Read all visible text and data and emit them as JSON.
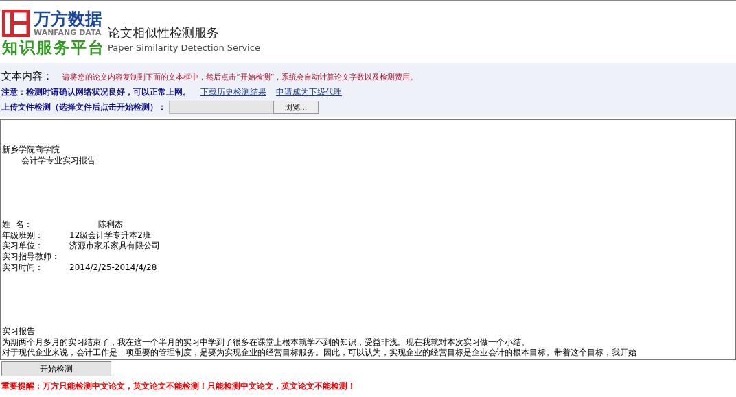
{
  "header": {
    "brand": "万方数据",
    "brand_en": "WANFANG DATA",
    "platform": "知识服务平台",
    "service_title": "论文相似性检测服务",
    "service_title_en": "Paper Similarity Detection Service"
  },
  "info": {
    "label": "文本内容：",
    "instruction": "请将您的论文内容复制到下面的文本框中，然后点击“开始检测”，系统会自动计算论文字数以及检测费用。",
    "notice": "注意：检测时请确认网络状况良好，可以正常上网。",
    "links": [
      "下载历史检测结果",
      "申请成为下级代理"
    ],
    "upload_label": "上传文件检测（选择文件后点击开始检测）：",
    "browse_button": "浏览..."
  },
  "text_box": {
    "school": "新乡学院商学院",
    "report_title": "会计学专业实习报告",
    "fields": [
      {
        "label": "姓  名：",
        "value": "陈利杰"
      },
      {
        "label": "年级班别：",
        "value": "12级会计学专升本2班"
      },
      {
        "label": "实习单位：",
        "value": "济源市家乐家具有限公司"
      },
      {
        "label": "实习指导教师："
      },
      {
        "label": "实习时间：",
        "value": "2014/2/25-2014/4/28"
      }
    ],
    "section_title": "实习报告",
    "paragraphs": [
      "为期两个月多月的实习结束了，我在这一个半月的实习中学到了很多在课堂上根本就学不到的知识，受益非浅。现在我就对本次实习做一个小结。",
      "对于现代企业来说，会计工作是一项重要的管理制度，是要为实现企业的经营目标服务。因此，可以认为，实现企业的经营目标是企业会计的根本目标。带着这个目标，我开始"
    ]
  },
  "start_button": "开始检测",
  "warning": "重要提醒：万方只能检测中文论文，英文论文不能检测！只能检测中文论文，英文论文不能检测！"
}
